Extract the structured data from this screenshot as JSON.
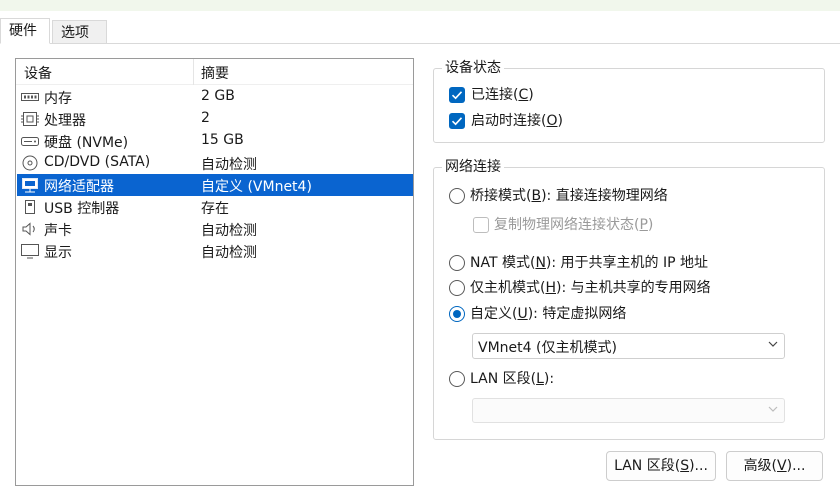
{
  "tabs": [
    {
      "label": "硬件"
    },
    {
      "label": "选项"
    }
  ],
  "device_list": {
    "columns": [
      "设备",
      "摘要"
    ],
    "rows": [
      {
        "icon": "memory-icon",
        "name": "内存",
        "summary": "2 GB"
      },
      {
        "icon": "processor-icon",
        "name": "处理器",
        "summary": "2"
      },
      {
        "icon": "hard-disk-icon",
        "name": "硬盘 (NVMe)",
        "summary": "15 GB"
      },
      {
        "icon": "cd-dvd-icon",
        "name": "CD/DVD (SATA)",
        "summary": "自动检测"
      },
      {
        "icon": "network-adapter-icon",
        "name": "网络适配器",
        "summary": "自定义 (VMnet4)",
        "selected": true
      },
      {
        "icon": "usb-icon",
        "name": "USB 控制器",
        "summary": "存在"
      },
      {
        "icon": "sound-card-icon",
        "name": "声卡",
        "summary": "自动检测"
      },
      {
        "icon": "display-icon",
        "name": "显示",
        "summary": "自动检测"
      }
    ]
  },
  "device_status": {
    "title": "设备状态",
    "connected": {
      "text": "已连接(",
      "key": "C",
      "tail": ")",
      "checked": true
    },
    "connect_at_power_on": {
      "text": "启动时连接(",
      "key": "O",
      "tail": ")",
      "checked": true
    }
  },
  "network_connection": {
    "title": "网络连接",
    "bridged": {
      "text": "桥接模式(",
      "key": "B",
      "tail": "): 直接连接物理网络",
      "selected": false
    },
    "replicate": {
      "text": "复制物理网络连接状态(",
      "key": "P",
      "tail": ")",
      "checked": false,
      "disabled": true
    },
    "nat": {
      "text": "NAT 模式(",
      "key": "N",
      "tail": "): 用于共享主机的 IP 地址",
      "selected": false
    },
    "host_only": {
      "text": "仅主机模式(",
      "key": "H",
      "tail": "): 与主机共享的专用网络",
      "selected": false
    },
    "custom": {
      "text": "自定义(",
      "key": "U",
      "tail": "): 特定虚拟网络",
      "selected": true
    },
    "custom_select_value": "VMnet4 (仅主机模式)",
    "lan_segment": {
      "text": "LAN 区段(",
      "key": "L",
      "tail": "):",
      "selected": false
    },
    "lan_select_value": ""
  },
  "buttons": {
    "lan_segments": {
      "text": "LAN 区段(",
      "key": "S",
      "tail": ")..."
    },
    "advanced": {
      "text": "高级(",
      "key": "V",
      "tail": ")..."
    }
  },
  "colors": {
    "selection": "#0a64d0",
    "accent": "#0067c0"
  }
}
